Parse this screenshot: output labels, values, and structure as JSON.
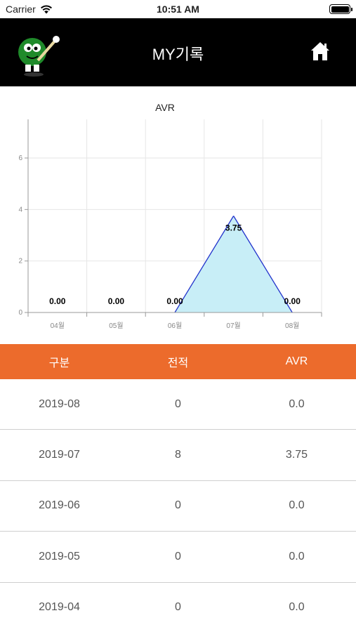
{
  "status": {
    "carrier": "Carrier",
    "time": "10:51 AM"
  },
  "nav": {
    "title": "MY기록"
  },
  "chart_data": {
    "type": "area",
    "title": "AVR",
    "categories": [
      "04월",
      "05월",
      "06월",
      "07월",
      "08월"
    ],
    "values": [
      0.0,
      0.0,
      0.0,
      3.75,
      0.0
    ],
    "value_labels": [
      "0.00",
      "0.00",
      "0.00",
      "3.75",
      "0.00"
    ],
    "ylim": [
      0,
      7.5
    ],
    "yticks": [
      0,
      2,
      4,
      6
    ],
    "grid": true,
    "colors": {
      "line": "#2233cc",
      "fill": "#c8eef7"
    }
  },
  "table": {
    "headers": [
      "구분",
      "전적",
      "AVR"
    ],
    "rows": [
      [
        "2019-08",
        "0",
        "0.0"
      ],
      [
        "2019-07",
        "8",
        "3.75"
      ],
      [
        "2019-06",
        "0",
        "0.0"
      ],
      [
        "2019-05",
        "0",
        "0.0"
      ],
      [
        "2019-04",
        "0",
        "0.0"
      ]
    ]
  },
  "colors": {
    "header_bar": "#ec6b2c",
    "nav_bg": "#000000"
  },
  "icons": {
    "logo": "mascot-logo-icon",
    "home": "home-icon",
    "wifi": "wifi-icon",
    "battery": "battery-icon"
  }
}
